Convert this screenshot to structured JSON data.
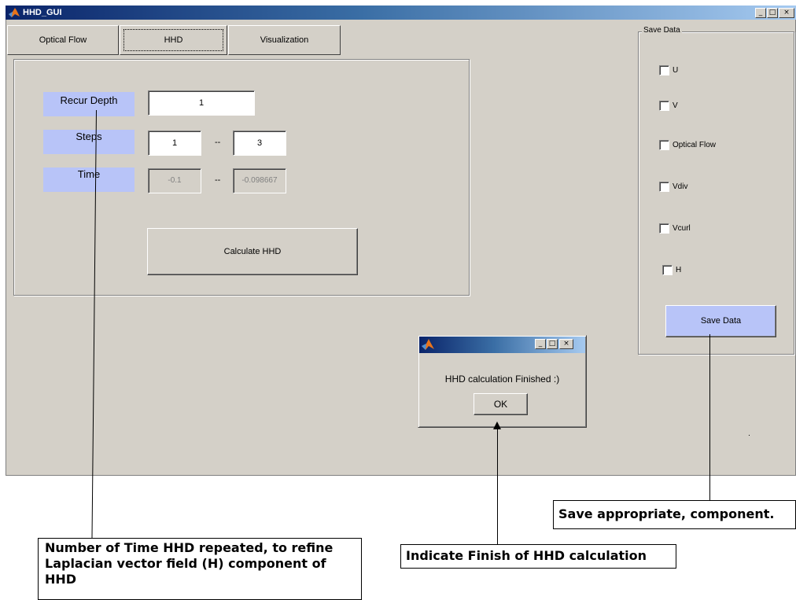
{
  "window": {
    "title": "HHD_GUI",
    "controls": [
      "_",
      "□",
      "×"
    ]
  },
  "tabs": [
    {
      "label": "Optical Flow",
      "active": false
    },
    {
      "label": "HHD",
      "active": true
    },
    {
      "label": "Visualization",
      "active": false
    }
  ],
  "hhd_panel": {
    "recur_depth": {
      "label": "Recur  Depth",
      "value": "1"
    },
    "steps": {
      "label": "Steps",
      "from": "1",
      "separator": "--",
      "to": "3"
    },
    "time": {
      "label": "Time",
      "from": "-0.1",
      "separator": "--",
      "to": "-0.098667"
    },
    "calculate_button": "Calculate HHD"
  },
  "save_data": {
    "legend": "Save Data",
    "options": [
      {
        "label": "U",
        "checked": false
      },
      {
        "label": "V",
        "checked": false
      },
      {
        "label": "Optical Flow",
        "checked": false
      },
      {
        "label": "Vdiv",
        "checked": false
      },
      {
        "label": "Vcurl",
        "checked": false
      },
      {
        "label": "H",
        "checked": false
      }
    ],
    "button": "Save Data"
  },
  "dialog": {
    "message": "HHD calculation Finished :)",
    "ok": "OK"
  },
  "annotations": {
    "recur_depth_note": "Number of Time HHD repeated, to refine Laplacian vector field (H) component of HHD",
    "finish_note": "Indicate Finish of HHD calculation",
    "save_note": "Save appropriate, component."
  },
  "colors": {
    "window_bg": "#d4d0c8",
    "label_bg": "#b8c4f8",
    "title_gradient_start": "#0a246a",
    "title_gradient_end": "#a6caf0"
  }
}
